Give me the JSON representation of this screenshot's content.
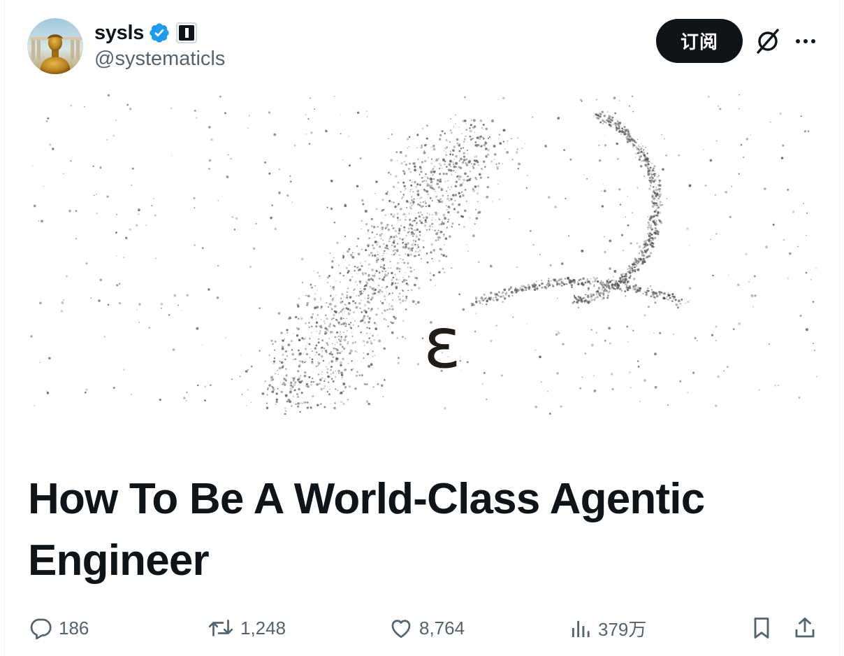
{
  "author": {
    "display_name": "sysls",
    "handle": "@systematicls",
    "verified": true,
    "avatar": "avatar-statue"
  },
  "header": {
    "subscribe_label": "订阅",
    "grok_icon": "grok-icon",
    "more_icon": "more-icon"
  },
  "article": {
    "cover_glyph": "ɛ",
    "title": "How To Be A World-Class Agentic Engineer"
  },
  "engagement": {
    "replies": "186",
    "reposts": "1,248",
    "likes": "8,764",
    "views": "379万"
  },
  "colors": {
    "text_primary": "#0f1419",
    "text_secondary": "#536471",
    "verified_blue": "#1d9bf0",
    "button_bg": "#0f1419"
  }
}
